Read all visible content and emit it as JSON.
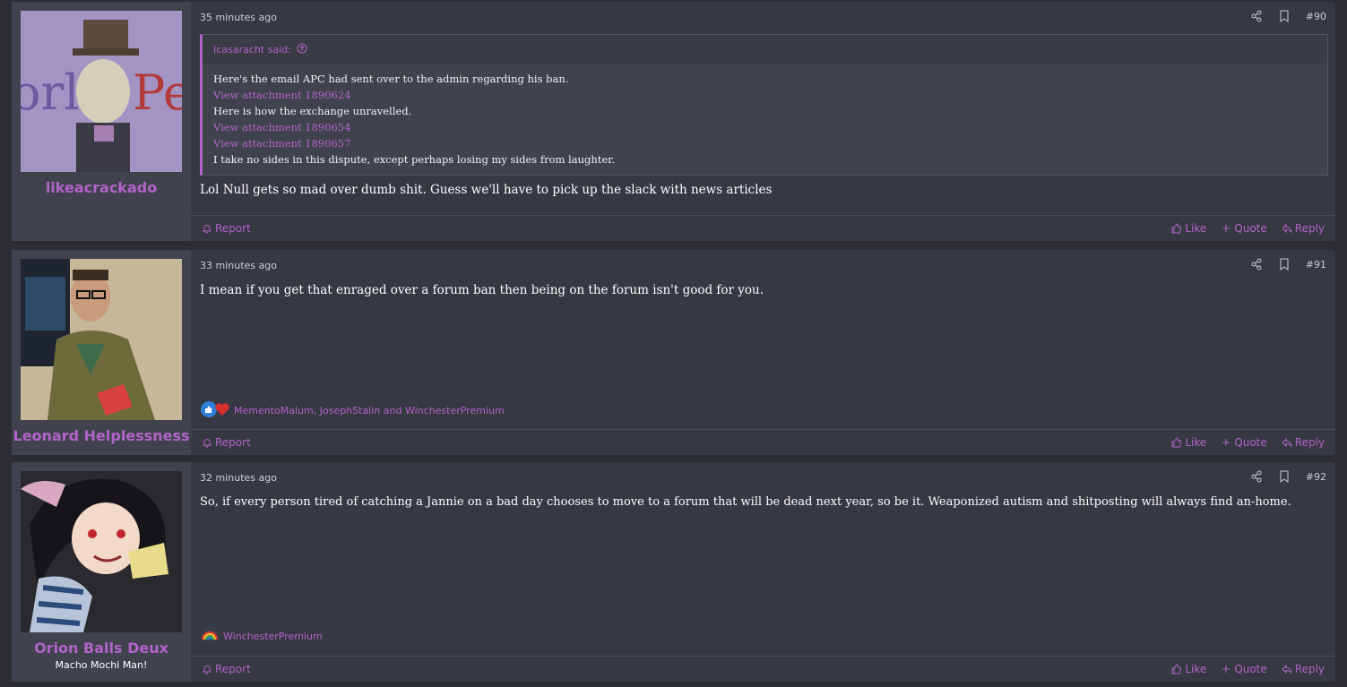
{
  "colors": {
    "accent": "#b163c9",
    "post_bg": "#363842",
    "user_bg": "#40434d",
    "page_bg": "#2b2d33"
  },
  "actions": {
    "report": "Report",
    "like": "Like",
    "quote": "Quote",
    "reply": "Reply"
  },
  "posts": [
    {
      "time": "35 minutes ago",
      "number": "#90",
      "username": "likeacrackado",
      "quote": {
        "author": "Icasaracht said:",
        "lines": [
          "Here's the email APC had sent over to the admin regarding his ban.",
          "View attachment 1890624",
          "Here is how the exchange unravelled.",
          "View attachment 1890654",
          "View attachment 1890657",
          "I take no sides in this dispute, except perhaps losing my sides from laughter."
        ]
      },
      "body": "Lol Null gets so mad over dumb shit. Guess we'll have to pick up the slack with news articles"
    },
    {
      "time": "33 minutes ago",
      "number": "#91",
      "username": "Leonard Helplessness",
      "body": "I mean if you get that enraged over a forum ban then being on the forum isn't good for you.",
      "reactions": "MementoMalum, JosephStalin and WinchesterPremium"
    },
    {
      "time": "32 minutes ago",
      "number": "#92",
      "username": "Orion Balls Deux",
      "user_title": "Macho Mochi Man!",
      "body": "So, if every person tired of catching a Jannie on a bad day chooses to move to a forum that will be dead next year, so be it. Weaponized autism and shitposting will always find an-home.",
      "reactions": "WinchesterPremium"
    }
  ]
}
